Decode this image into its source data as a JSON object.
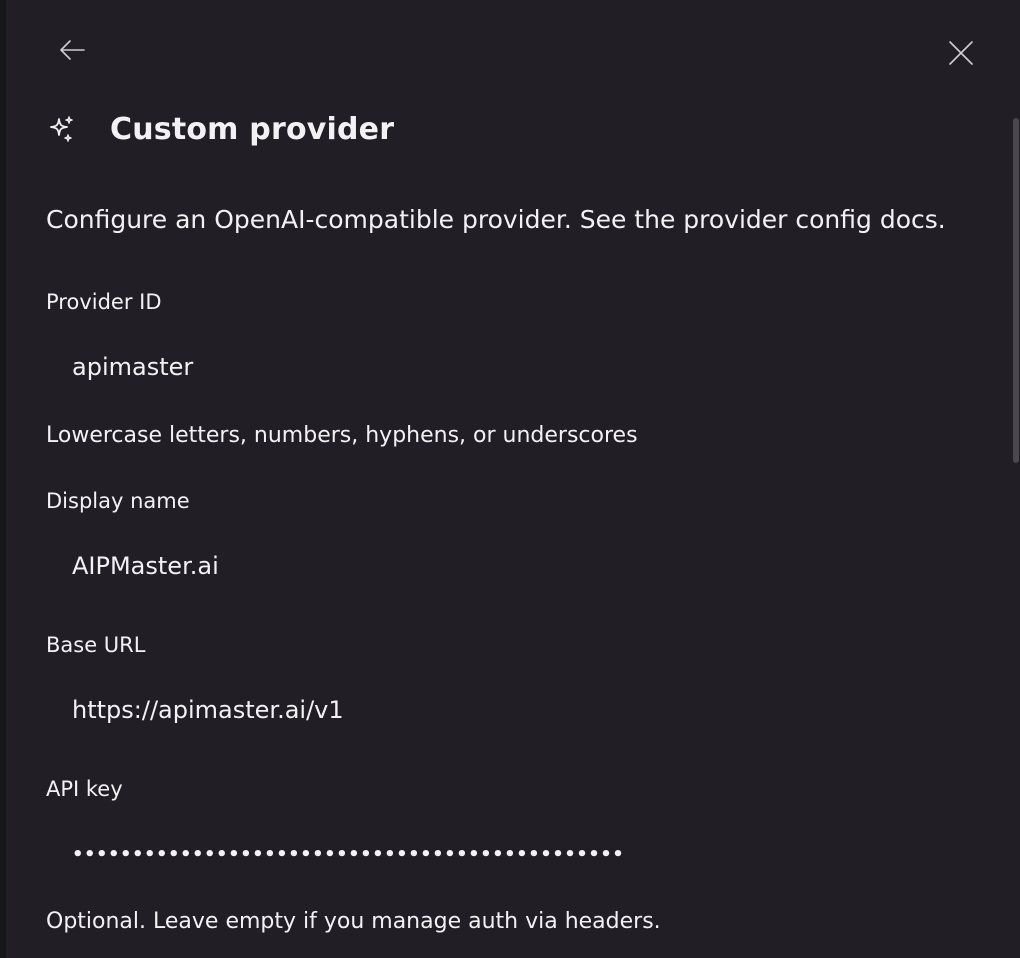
{
  "header": {
    "title": "Custom provider"
  },
  "description": "Configure an OpenAI-compatible provider. See the provider config docs.",
  "fields": {
    "provider_id": {
      "label": "Provider ID",
      "value": "apimaster",
      "hint": "Lowercase letters, numbers, hyphens, or underscores"
    },
    "display_name": {
      "label": "Display name",
      "value": "AIPMaster.ai"
    },
    "base_url": {
      "label": "Base URL",
      "value": "https://apimaster.ai/v1"
    },
    "api_key": {
      "label": "API key",
      "value": "••••••••••••••••••••••••••••••••••••••••••••••",
      "hint": "Optional. Leave empty if you manage auth via headers."
    }
  },
  "icons": {
    "back": "arrow-left-icon",
    "close": "close-icon",
    "sparkle": "sparkle-icon"
  },
  "colors": {
    "background": "#211f25",
    "text": "#f2f2f4",
    "scrollbar": "#4a484f"
  }
}
